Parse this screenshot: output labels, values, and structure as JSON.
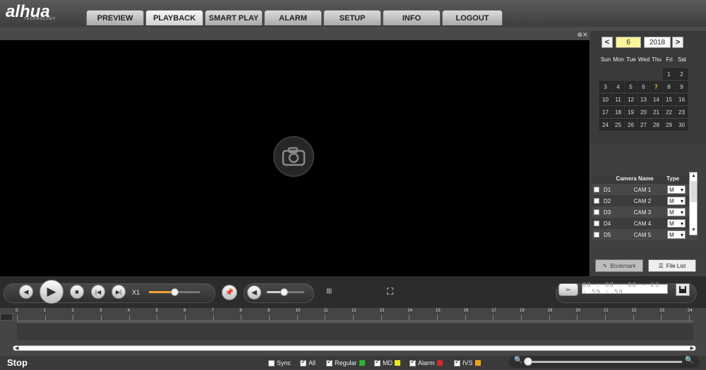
{
  "app": {
    "logo": "alhua",
    "logo_sub": "TECHNOLOGY"
  },
  "nav": {
    "tabs": [
      {
        "label": "PREVIEW",
        "active": false
      },
      {
        "label": "PLAYBACK",
        "active": true
      },
      {
        "label": "SMART PLAY",
        "active": false
      },
      {
        "label": "ALARM",
        "active": false
      },
      {
        "label": "SETUP",
        "active": false
      },
      {
        "label": "INFO",
        "active": false
      },
      {
        "label": "LOGOUT",
        "active": false
      }
    ]
  },
  "video": {
    "zoom_icon": "zoom-icon",
    "close_icon": "close-icon",
    "placeholder_icon": "camera-icon"
  },
  "calendar": {
    "prev": "<",
    "next": ">",
    "month": "6",
    "year": "2018",
    "weekdays": [
      "Sun",
      "Mon",
      "Tue",
      "Wed",
      "Thu",
      "Fri",
      "Sat"
    ],
    "days": [
      "",
      "",
      "",
      "",
      "",
      "1",
      "2",
      "3",
      "4",
      "5",
      "6",
      "7",
      "8",
      "9",
      "10",
      "11",
      "12",
      "13",
      "14",
      "15",
      "16",
      "17",
      "18",
      "19",
      "20",
      "21",
      "22",
      "23",
      "24",
      "25",
      "26",
      "27",
      "28",
      "29",
      "30"
    ],
    "highlight_day": "7"
  },
  "cameras": {
    "header_name": "Camera Name",
    "header_type": "Type",
    "rows": [
      {
        "id": "D1",
        "name": "CAM 1",
        "type": "M"
      },
      {
        "id": "D2",
        "name": "CAM 2",
        "type": "M"
      },
      {
        "id": "D3",
        "name": "CAM 3",
        "type": "M"
      },
      {
        "id": "D4",
        "name": "CAM 4",
        "type": "M"
      },
      {
        "id": "D5",
        "name": "CAM 5",
        "type": "M"
      }
    ]
  },
  "panel_buttons": {
    "bookmark": "Bookmark",
    "file_list": "File List"
  },
  "controls": {
    "speed": "X1",
    "speed_level": 0.5,
    "volume_level": 0.45,
    "time_range": "00 : 00 : 00 ~ 23 : 59 : 59"
  },
  "timeline": {
    "hours": [
      "0",
      "1",
      "2",
      "3",
      "4",
      "5",
      "6",
      "7",
      "8",
      "9",
      "10",
      "11",
      "12",
      "13",
      "14",
      "15",
      "16",
      "17",
      "18",
      "19",
      "20",
      "21",
      "22",
      "23",
      "24"
    ]
  },
  "status": {
    "state": "Stop",
    "filters": [
      {
        "label": "Sync",
        "checked": false,
        "color": ""
      },
      {
        "label": "All",
        "checked": true,
        "color": ""
      },
      {
        "label": "Regular",
        "checked": true,
        "color": "#2fb52f"
      },
      {
        "label": "MD",
        "checked": true,
        "color": "#e6e62a"
      },
      {
        "label": "Alarm",
        "checked": true,
        "color": "#d12a2a"
      },
      {
        "label": "IVS",
        "checked": true,
        "color": "#f0a020"
      }
    ]
  },
  "colors": {
    "accent_orange": "#f0a23a",
    "highlight_day": "#f5c400",
    "month_bg": "#fbf59a"
  }
}
